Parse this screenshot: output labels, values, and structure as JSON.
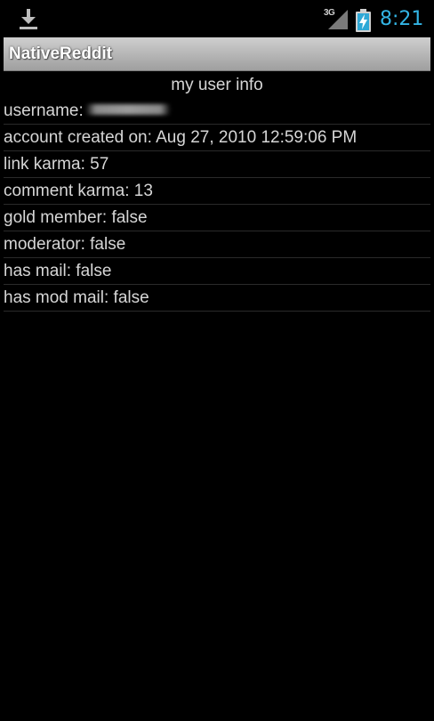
{
  "status_bar": {
    "network": "3G",
    "time": "8:21",
    "icons": [
      "download-icon",
      "signal-icon",
      "battery-charging-icon"
    ]
  },
  "app": {
    "title": "NativeReddit"
  },
  "section": {
    "title": "my user info"
  },
  "user_info": {
    "username_label": "username:",
    "rows": [
      "account created on: Aug 27, 2010 12:59:06 PM",
      "link karma: 57",
      "comment karma: 13",
      "gold member: false",
      "moderator: false",
      "has mail: false",
      "has mod mail: false"
    ]
  },
  "colors": {
    "clock": "#33b5e5",
    "background": "#000000",
    "text": "#d6d6d6"
  }
}
